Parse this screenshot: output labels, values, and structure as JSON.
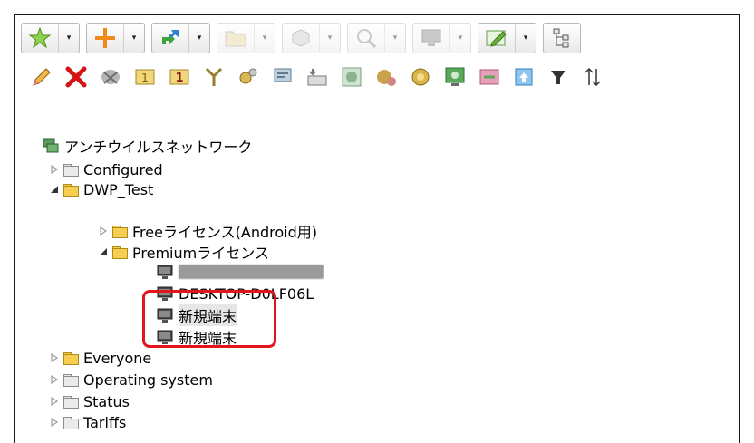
{
  "toolbar_top": {
    "groups": [
      {
        "icon": "star-icon",
        "disabled": false
      },
      {
        "icon": "plus-icon",
        "disabled": false
      },
      {
        "icon": "move-arrows-icon",
        "disabled": false
      },
      {
        "icon": "folder-icon",
        "disabled": true
      },
      {
        "icon": "box-icon",
        "disabled": true
      },
      {
        "icon": "search-icon",
        "disabled": true
      },
      {
        "icon": "monitor-icon",
        "disabled": true
      },
      {
        "icon": "edit-icon",
        "disabled": false
      },
      {
        "icon": "tree-layout-icon",
        "disabled": false
      }
    ]
  },
  "toolbar_bottom": {
    "icons": [
      "pencil-icon",
      "delete-icon",
      "remove-policy-icon",
      "one-icon",
      "one-bold-icon",
      "merge-icon",
      "settings-gear-icon",
      "message-icon",
      "keyboard-icon",
      "scan-icon",
      "virus-settings-icon",
      "shield-icon",
      "monitor-search-icon",
      "transfer-icon",
      "up-arrow-icon",
      "filter-icon",
      "sort-icon"
    ]
  },
  "tree": {
    "root": "アンチウイルスネットワーク",
    "items": [
      {
        "label": "Configured"
      },
      {
        "label": "DWP_Test"
      },
      {
        "label": "Freeライセンス(Android用)"
      },
      {
        "label": "Premiumライセンス"
      },
      {
        "label": ""
      },
      {
        "label": "DESKTOP-D0LF06L"
      },
      {
        "label": "新規端末"
      },
      {
        "label": "新規端末"
      },
      {
        "label": "Everyone"
      },
      {
        "label": "Operating system"
      },
      {
        "label": "Status"
      },
      {
        "label": "Tariffs"
      }
    ]
  },
  "colors": {
    "highlight": "#e4141e",
    "folder_yellow": "#f6cf52",
    "folder_grey": "#eaeaea"
  }
}
